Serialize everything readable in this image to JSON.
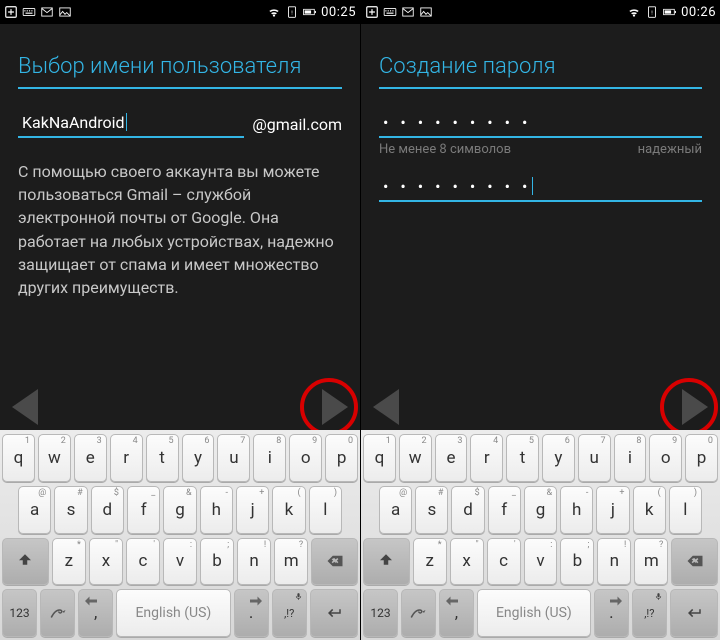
{
  "statusbar": {
    "time_left": "00:25",
    "time_right": "00:26"
  },
  "left": {
    "title": "Выбор имени пользователя",
    "username": "KakNaAndroid",
    "suffix": "@gmail.com",
    "description": "С помощью своего аккаунта вы можете пользоваться Gmail – службой электронной почты от Google. Она работает на любых устройствах, надежно защищает от спама и имеет множество других преимуществ."
  },
  "right": {
    "title": "Создание пароля",
    "password1": "• • • • • • • • •",
    "password2": "• • • • • • • • •",
    "hint_left": "Не менее 8 символов",
    "hint_right": "надежный"
  },
  "keyboard": {
    "row1": [
      {
        "k": "q",
        "s": "1"
      },
      {
        "k": "w",
        "s": "2"
      },
      {
        "k": "e",
        "s": "3"
      },
      {
        "k": "r",
        "s": "4"
      },
      {
        "k": "t",
        "s": "5"
      },
      {
        "k": "y",
        "s": "6"
      },
      {
        "k": "u",
        "s": "7"
      },
      {
        "k": "i",
        "s": "8"
      },
      {
        "k": "o",
        "s": "9"
      },
      {
        "k": "p",
        "s": "0"
      }
    ],
    "row2": [
      {
        "k": "a",
        "s": "@"
      },
      {
        "k": "s",
        "s": "#"
      },
      {
        "k": "d",
        "s": "$"
      },
      {
        "k": "f",
        "s": "_"
      },
      {
        "k": "g",
        "s": "&"
      },
      {
        "k": "h",
        "s": "-"
      },
      {
        "k": "j",
        "s": "+"
      },
      {
        "k": "k",
        "s": "("
      },
      {
        "k": "l",
        "s": ")"
      }
    ],
    "row3": [
      {
        "k": "z",
        "s": "*"
      },
      {
        "k": "x",
        "s": "\""
      },
      {
        "k": "c",
        "s": "'"
      },
      {
        "k": "v",
        "s": ":"
      },
      {
        "k": "b",
        "s": ";"
      },
      {
        "k": "n",
        "s": "!"
      },
      {
        "k": "m",
        "s": "?"
      }
    ],
    "space_label": "English (US)",
    "numkey": "123",
    "comma": ",",
    "period": ".",
    "punct": ",!?"
  }
}
